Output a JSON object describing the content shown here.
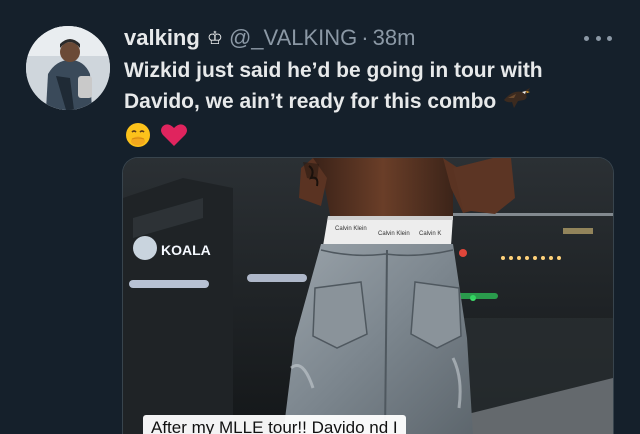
{
  "tweet": {
    "display_name": "valking",
    "badge_icon": "crown-icon",
    "handle": "@_VALKING",
    "separator": "·",
    "time": "38m",
    "text": "Wizkid just said he’d be going in tour with Davido, we ain’t ready for this combo",
    "emojis": [
      "eagle-icon",
      "hand-over-mouth-icon",
      "red-heart-icon"
    ],
    "more_icon": "more-horizontal-icon"
  },
  "media": {
    "sign_text": "KOALA",
    "caption": "After my MLLE tour!! Davido nd I"
  },
  "colors": {
    "background": "#15202b",
    "primary_text": "#e7e9ea",
    "secondary_text": "#8b98a5",
    "heart": "#e0245e"
  }
}
